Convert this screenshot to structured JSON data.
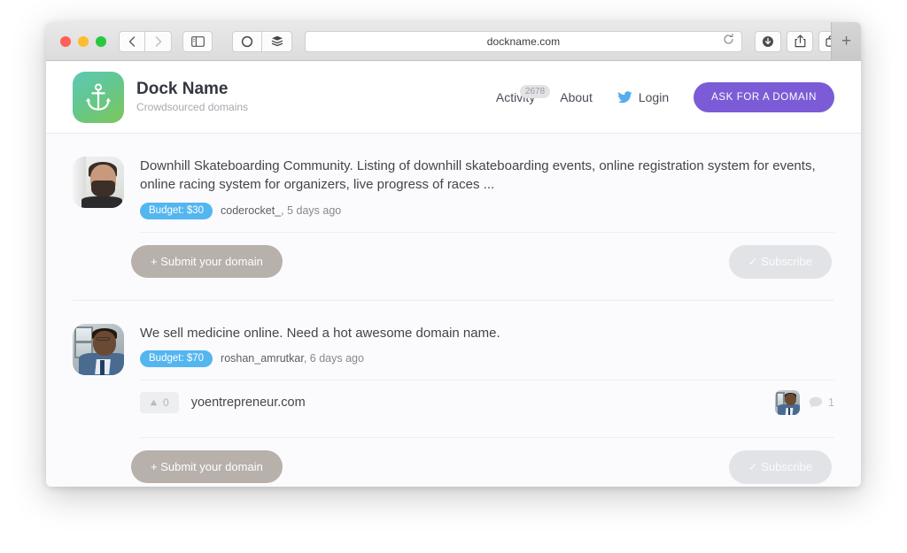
{
  "browser": {
    "url": "dockname.com",
    "back_icon": "chevron-left-icon",
    "forward_icon": "chevron-right-icon",
    "sidebar_icon": "sidebar-icon",
    "privacy_icon": "circle-icon",
    "reader_icon": "layers-icon",
    "reload_icon": "reload-icon",
    "downloads_icon": "download-icon",
    "share_icon": "share-icon",
    "tabs_icon": "tabs-icon",
    "new_tab_label": "+"
  },
  "site": {
    "logo_icon": "anchor-icon",
    "brand_title": "Dock Name",
    "brand_subtitle": "Crowdsourced domains",
    "nav": {
      "activity_label": "Activity",
      "activity_badge": "2678",
      "about_label": "About",
      "twitter_icon": "twitter-icon",
      "login_label": "Login",
      "cta_label": "ASK FOR A DOMAIN"
    }
  },
  "colors": {
    "accent_purple": "#7b5cd6",
    "budget_blue": "#54b6ef",
    "submit_gray": "#b7b0ab",
    "subscribe_gray": "#e2e3e6",
    "logo_green": "#63c78e",
    "twitter_blue": "#55acee"
  },
  "posts": [
    {
      "avatar_name": "avatar-coderocket",
      "text": "Downhill Skateboarding Community. Listing of downhill skateboarding events, online registration system for events, online racing system for organizers, live progress of races ...",
      "budget_label": "Budget: $30",
      "user": "coderocket_",
      "timestamp": ", 5 days ago",
      "submit_label": "+  Submit your domain",
      "subscribe_label": "✓ Subscribe",
      "domains": []
    },
    {
      "avatar_name": "avatar-roshan",
      "text": "We sell medicine online. Need a hot awesome domain name.",
      "budget_label": "Budget: $70",
      "user": "roshan_amrutkar",
      "timestamp": ", 6 days ago",
      "submit_label": "+  Submit your domain",
      "subscribe_label": "✓ Subscribe",
      "domains": [
        {
          "votes": "0",
          "vote_icon": "upvote-icon",
          "name": "yoentrepreneur.com",
          "comment_icon": "comment-icon",
          "comment_count": "1"
        }
      ]
    }
  ]
}
